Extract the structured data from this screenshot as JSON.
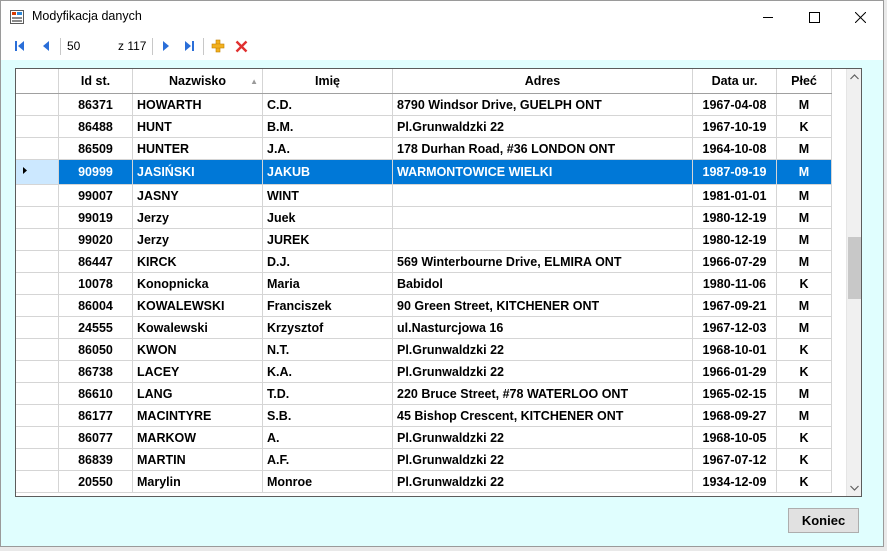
{
  "window": {
    "title": "Modyfikacja danych"
  },
  "navigator": {
    "position": "50",
    "of_label": "z 117"
  },
  "grid": {
    "columns": [
      "Id st.",
      "Nazwisko",
      "Imię",
      "Adres",
      "Data ur.",
      "Płeć"
    ],
    "rows": [
      [
        "86371",
        "HOWARTH",
        "C.D.",
        "8790 Windsor Drive, GUELPH ONT",
        "1967-04-08",
        "M"
      ],
      [
        "86488",
        "HUNT",
        "B.M.",
        "Pl.Grunwaldzki 22",
        "1967-10-19",
        "K"
      ],
      [
        "86509",
        "HUNTER",
        "J.A.",
        "178 Durhan Road, #36 LONDON ONT",
        "1964-10-08",
        "M"
      ],
      [
        "90999",
        "JASIŃSKI",
        "JAKUB",
        "WARMONTOWICE WIELKI",
        "1987-09-19",
        "M"
      ],
      [
        "99007",
        "JASNY",
        "WINT",
        "",
        "1981-01-01",
        "M"
      ],
      [
        "99019",
        "Jerzy",
        "Juek",
        "",
        "1980-12-19",
        "M"
      ],
      [
        "99020",
        "Jerzy",
        "JUREK",
        "",
        "1980-12-19",
        "M"
      ],
      [
        "86447",
        "KIRCK",
        "D.J.",
        "569 Winterbourne Drive, ELMIRA ONT",
        "1966-07-29",
        "M"
      ],
      [
        "10078",
        "Konopnicka",
        "Maria",
        "Babidol",
        "1980-11-06",
        "K"
      ],
      [
        "86004",
        "KOWALEWSKI",
        "Franciszek",
        "90 Green Street, KITCHENER ONT",
        "1967-09-21",
        "M"
      ],
      [
        "24555",
        "Kowalewski",
        "Krzysztof",
        "ul.Nasturcjowa 16",
        "1967-12-03",
        "M"
      ],
      [
        "86050",
        "KWON",
        "N.T.",
        "Pl.Grunwaldzki 22",
        "1968-10-01",
        "K"
      ],
      [
        "86738",
        "LACEY",
        "K.A.",
        "Pl.Grunwaldzki 22",
        "1966-01-29",
        "K"
      ],
      [
        "86610",
        "LANG",
        "T.D.",
        "220 Bruce Street, #78 WATERLOO ONT",
        "1965-02-15",
        "M"
      ],
      [
        "86177",
        "MACINTYRE",
        "S.B.",
        "45 Bishop Crescent, KITCHENER ONT",
        "1968-09-27",
        "M"
      ],
      [
        "86077",
        "MARKOW",
        "A.",
        "Pl.Grunwaldzki 22",
        "1968-10-05",
        "K"
      ],
      [
        "86839",
        "MARTIN",
        "A.F.",
        "Pl.Grunwaldzki 22",
        "1967-07-12",
        "K"
      ],
      [
        "20550",
        "Marylin",
        "Monroe",
        "Pl.Grunwaldzki 22",
        "1934-12-09",
        "K"
      ]
    ],
    "selected_row": 3
  },
  "buttons": {
    "close_label": "Koniec"
  },
  "colors": {
    "selection": "#0078d7",
    "client_background": "#e0fefe",
    "delete_icon": "#e0302f",
    "add_icon": "#f2b01e",
    "nav_icon": "#2a6ed8"
  },
  "icons": [
    "app-form-icon",
    "minimize-icon",
    "maximize-icon",
    "close-icon",
    "move-first-icon",
    "move-previous-icon",
    "move-next-icon",
    "move-last-icon",
    "add-new-icon",
    "delete-icon",
    "row-pointer-icon",
    "sort-arrow-icon"
  ]
}
